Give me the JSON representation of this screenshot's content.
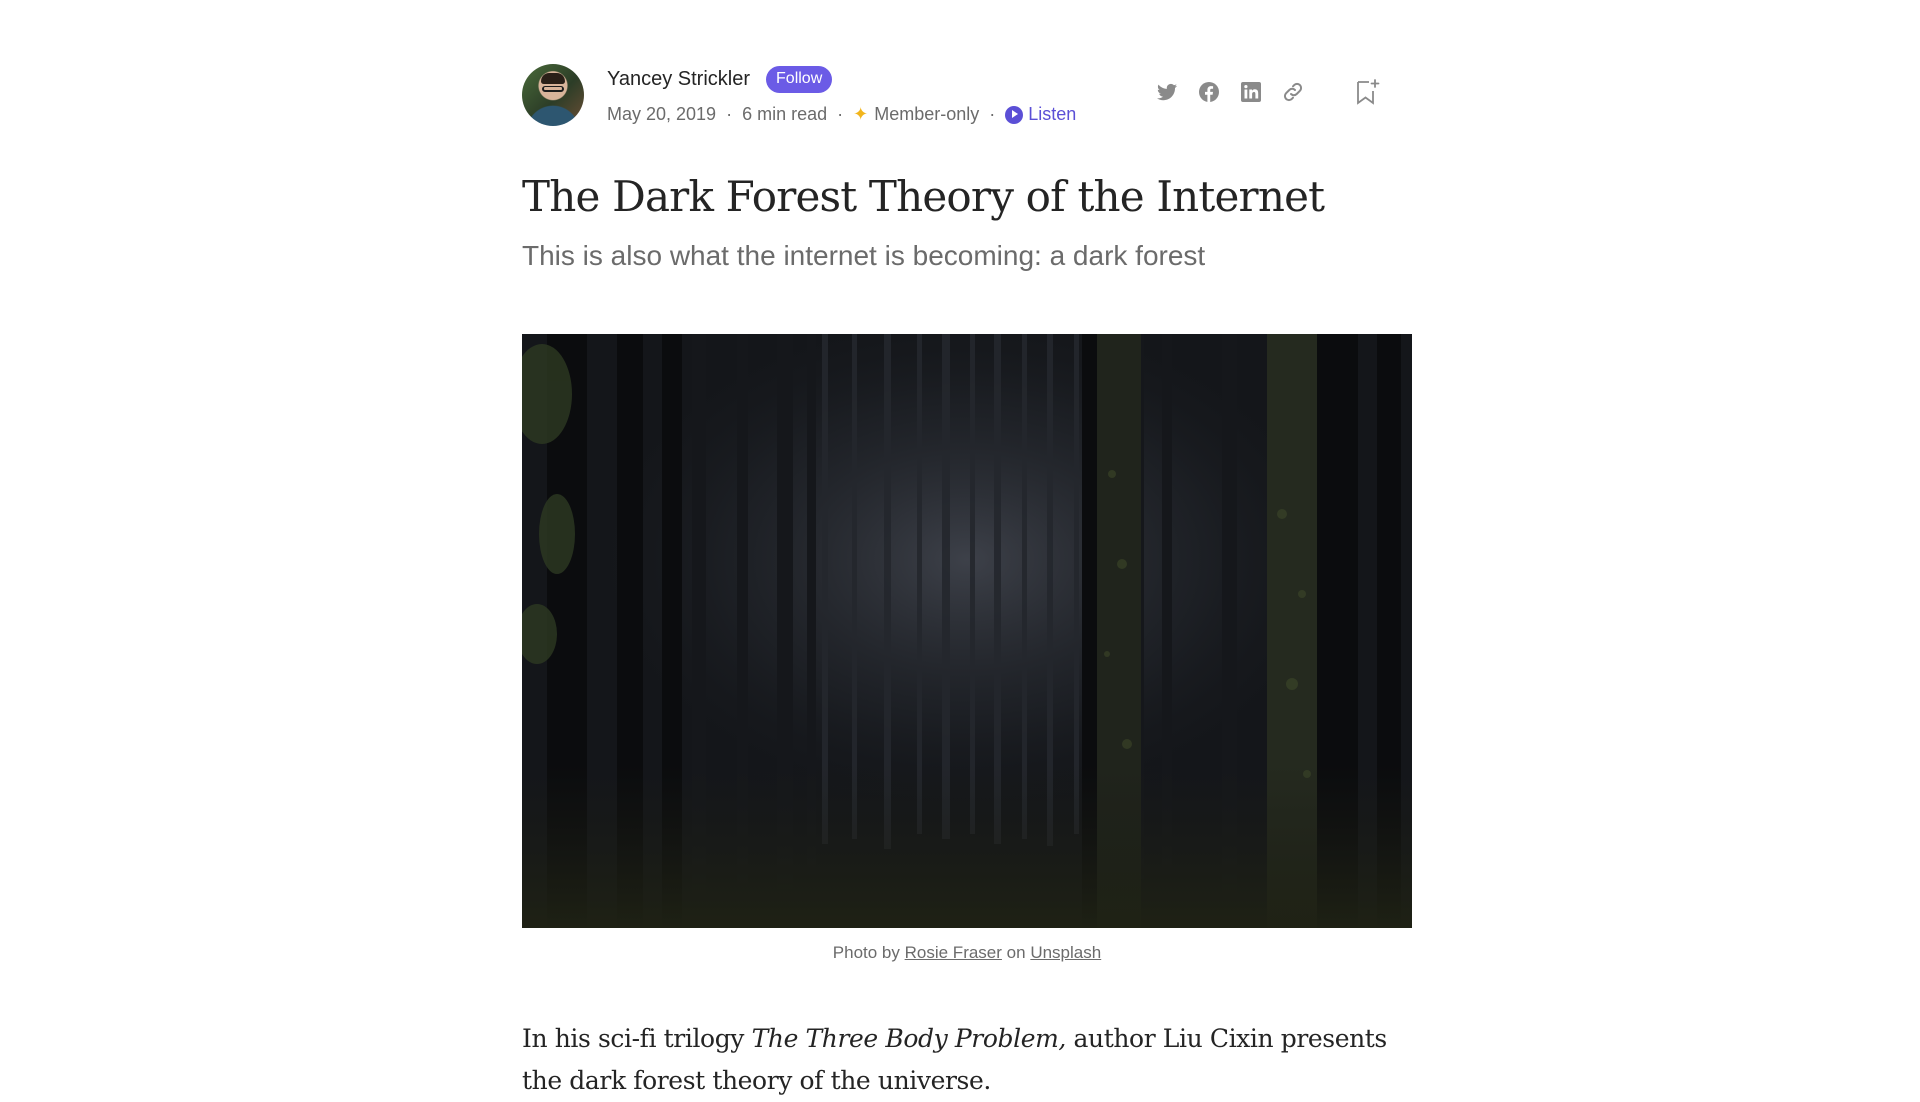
{
  "author": {
    "name": "Yancey Strickler",
    "follow_label": "Follow"
  },
  "meta": {
    "date": "May 20, 2019",
    "read_time": "6 min read",
    "separator": "·",
    "member_label": "Member-only",
    "listen_label": "Listen"
  },
  "share": {
    "icons": [
      "twitter-icon",
      "facebook-icon",
      "linkedin-icon",
      "link-icon",
      "bookmark-icon"
    ]
  },
  "article": {
    "title": "The Dark Forest Theory of the Internet",
    "subtitle": "This is also what the internet is becoming: a dark forest",
    "caption": {
      "prefix": "Photo by",
      "photographer": "Rosie Fraser",
      "middle": "on",
      "source": "Unsplash"
    },
    "body": {
      "part1": "In his sci-fi trilogy",
      "book": "The Three Body Problem,",
      "part2": "author Liu Cixin presents the dark forest theory of the universe."
    }
  },
  "colors": {
    "accent": "#6b5be6",
    "listen": "#5b4fd6",
    "star": "#f2b51c",
    "text": "#242424",
    "muted": "#6b6b6b"
  }
}
